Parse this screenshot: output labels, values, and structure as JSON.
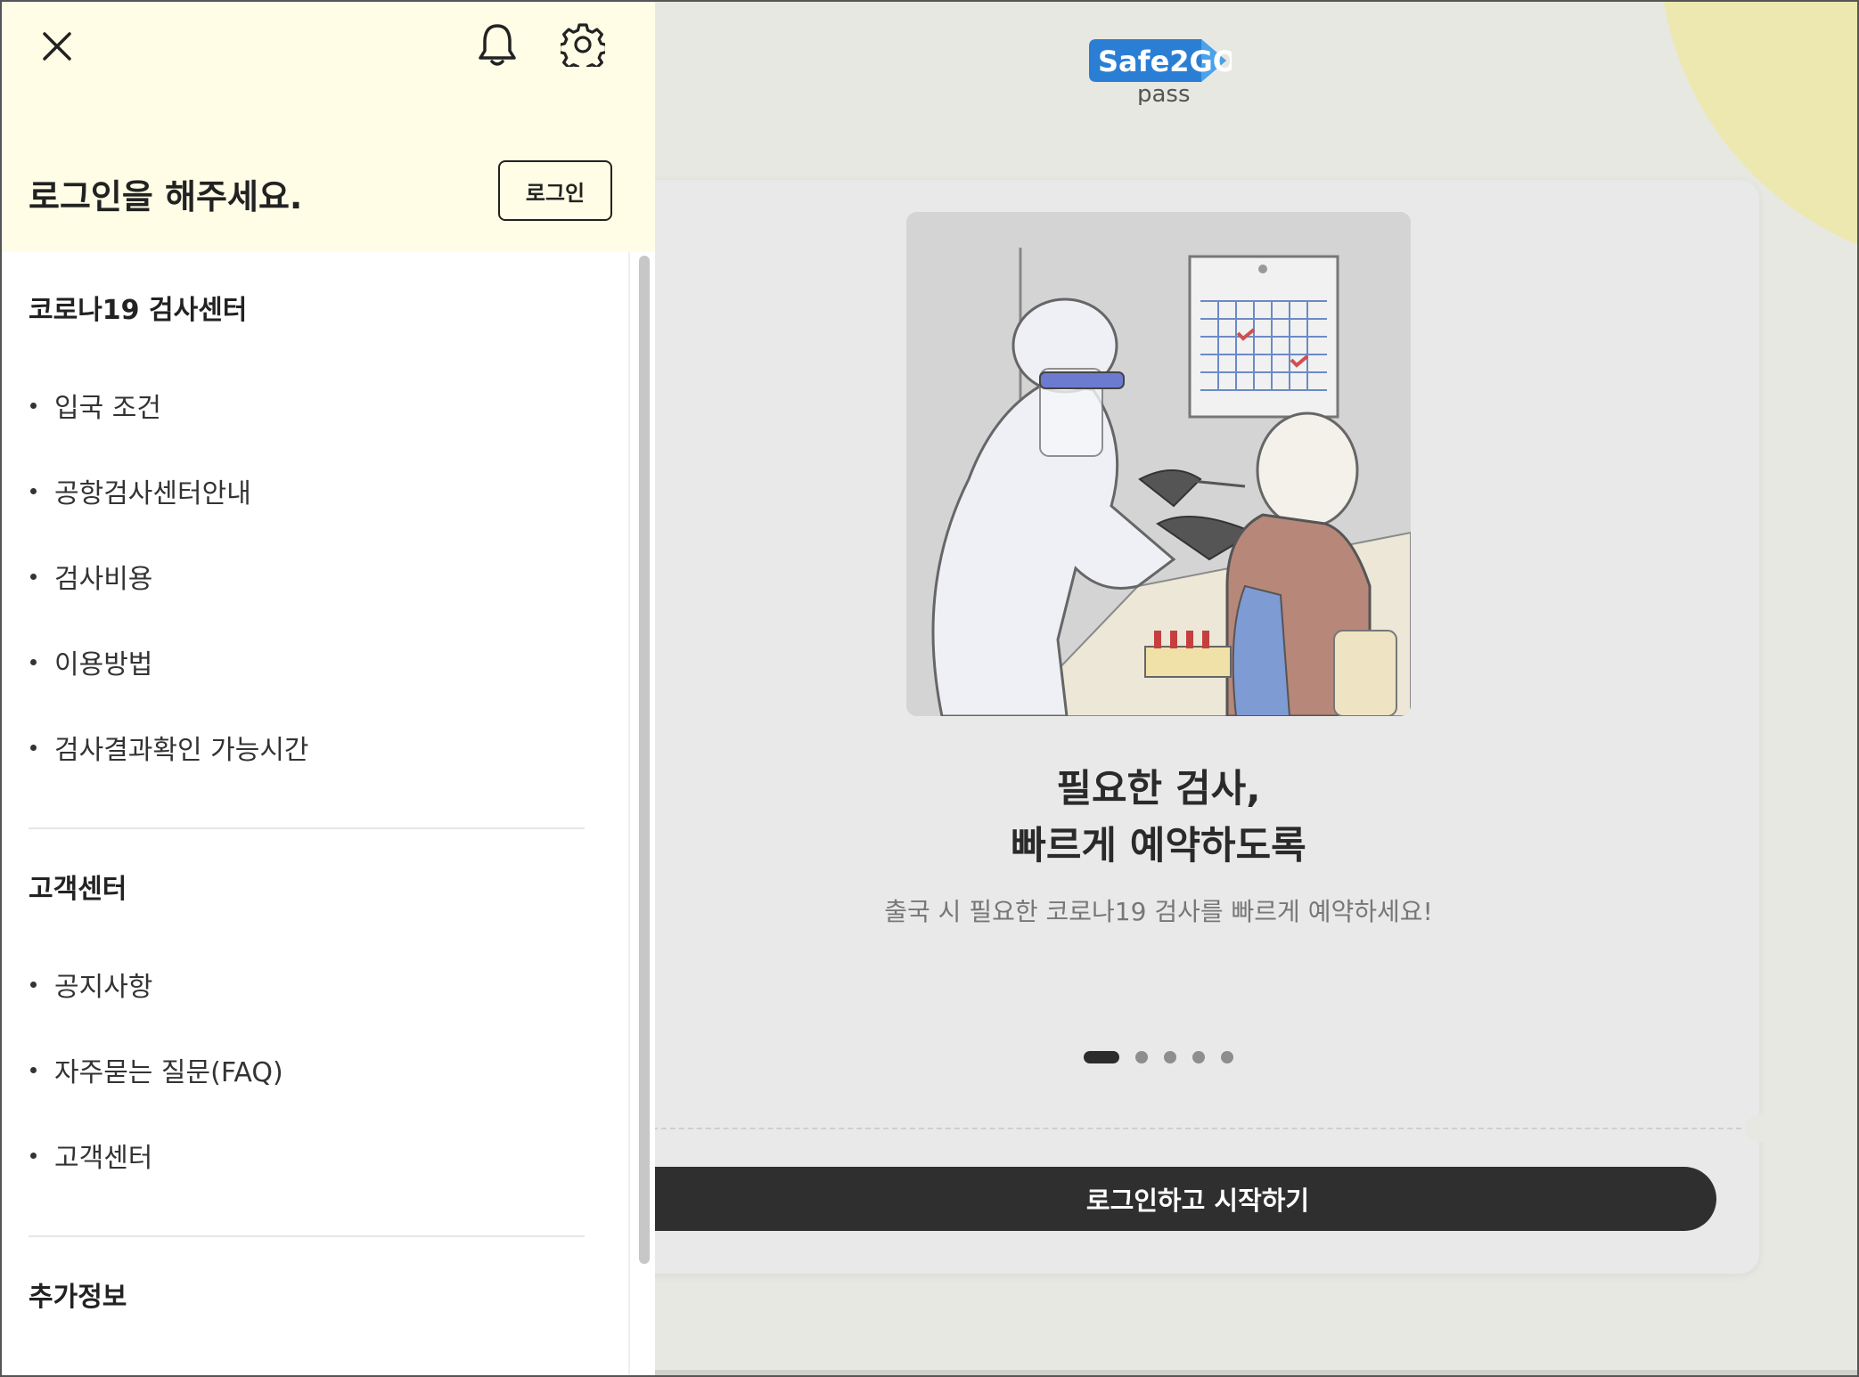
{
  "app": {
    "logo_text": "Safe2GO",
    "logo_sub": "pass"
  },
  "drawer": {
    "login_prompt": "로그인을 해주세요.",
    "login_button": "로그인",
    "sections": [
      {
        "title": "코로나19 검사센터",
        "items": [
          "입국 조건",
          "공항검사센터안내",
          "검사비용",
          "이용방법",
          "검사결과확인 가능시간"
        ]
      },
      {
        "title": "고객센터",
        "items": [
          "공지사항",
          "자주묻는 질문(FAQ)",
          "고객센터"
        ]
      },
      {
        "title": "추가정보",
        "items": []
      }
    ]
  },
  "onboarding": {
    "headline_line1": "필요한 검사,",
    "headline_line2": "빠르게 예약하도록",
    "subtext": "출국 시 필요한 코로나19 검사를 빠르게 예약하세요!",
    "page_total": 5,
    "page_current": 1,
    "start_button": "로그인하고 시작하기"
  },
  "icons": {
    "close": "close-icon",
    "bell": "bell-icon",
    "gear": "gear-icon"
  },
  "colors": {
    "drawer_header_bg": "#fffde6",
    "logo_blue": "#2a7fd4",
    "primary_dark": "#2f2f2f",
    "accent_blob": "#ece8b0"
  }
}
